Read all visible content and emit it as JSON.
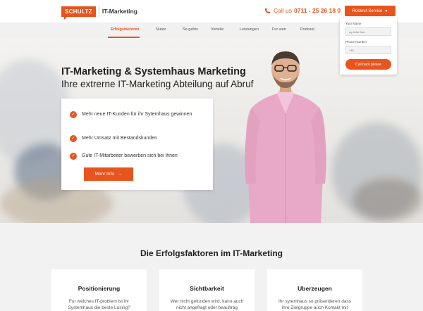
{
  "header": {
    "logo_box": "SCHULTZ",
    "logo_text": "IT-Marketing",
    "phone_prefix": "Call us",
    "phone_number": "0711 - 25 26 18 0",
    "callback_button": "Rückruf-Service"
  },
  "nav": {
    "items": [
      "Erfolgsfaktoren",
      "Nutze",
      "So gehts",
      "Vorteile",
      "Leistungen",
      "Fur wen",
      "Podcast"
    ],
    "active": "Erfolgsfaktoren"
  },
  "callback_form": {
    "name_label": "Your Name",
    "name_placeholder": "eg John Doe",
    "phone_label": "Phone Number",
    "phone_placeholder": "+49",
    "submit": "Call back please"
  },
  "hero": {
    "title": "IT-Marketing & Systemhaus Marketing",
    "subtitle": "Ihre extrerne IT-Marketing Abteilung auf Abruf",
    "benefits": [
      "Mehr neue IT-Kunden für ihr Sytemhaus gewinnen",
      "Mehr Umsatz mit Bestandskunden",
      "Gute IT-Mitarbeiter bewerben sich bei ihnen"
    ],
    "cta": "Mehr Info"
  },
  "section": {
    "title": "Die Erfolgsfaktoren im IT-Marketing",
    "features": [
      {
        "title": "Positionierung",
        "text": "Fur welches IT-problem ist ihr Systemhaus die beste Losing?"
      },
      {
        "title": "Sichtbarkeit",
        "text": "Wer nicht gefunden wird, kann auch nicht angefragt oder beauftrag"
      },
      {
        "title": "Uberzeugen",
        "text": "Ihr sytemhaus so präsentieren dass ihre Zielgruppe auch Kontakt mit"
      }
    ]
  },
  "colors": {
    "accent": "#e8541d",
    "nav_bg": "#f1f1f1",
    "section_bg": "#f2f2f2"
  }
}
